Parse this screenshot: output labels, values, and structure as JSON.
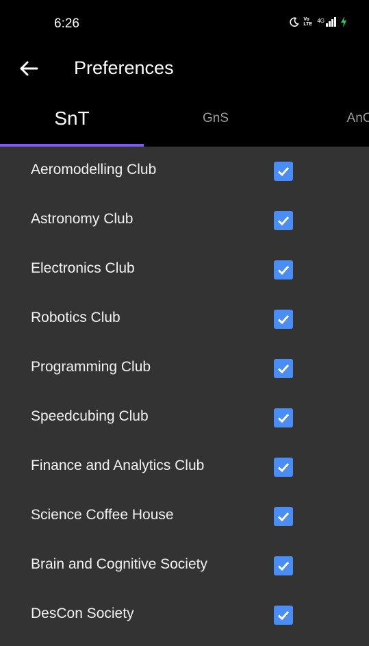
{
  "status_bar": {
    "time": "6:26",
    "volte_line1": "Vo",
    "volte_line2": "LTE",
    "network": "4G",
    "icons": [
      "moon-icon",
      "volte-icon",
      "signal-icon",
      "charging-icon"
    ]
  },
  "app_bar": {
    "title": "Preferences",
    "back_icon": "arrow-left-icon"
  },
  "tabs": [
    {
      "label": "SnT",
      "active": true
    },
    {
      "label": "GnS",
      "active": false
    },
    {
      "label": "AnC",
      "active": false
    }
  ],
  "colors": {
    "background": "#333333",
    "bars": "#000000",
    "accent_indicator": "#7a5cf0",
    "checkbox": "#4a8ef5"
  },
  "clubs": [
    {
      "label": "Aeromodelling Club",
      "checked": true
    },
    {
      "label": "Astronomy Club",
      "checked": true
    },
    {
      "label": "Electronics Club",
      "checked": true
    },
    {
      "label": "Robotics Club",
      "checked": true
    },
    {
      "label": "Programming Club",
      "checked": true
    },
    {
      "label": "Speedcubing Club",
      "checked": true
    },
    {
      "label": "Finance and Analytics Club",
      "checked": true
    },
    {
      "label": "Science Coffee House",
      "checked": true
    },
    {
      "label": "Brain and Cognitive Society",
      "checked": true
    },
    {
      "label": "DesCon Society",
      "checked": true
    }
  ]
}
